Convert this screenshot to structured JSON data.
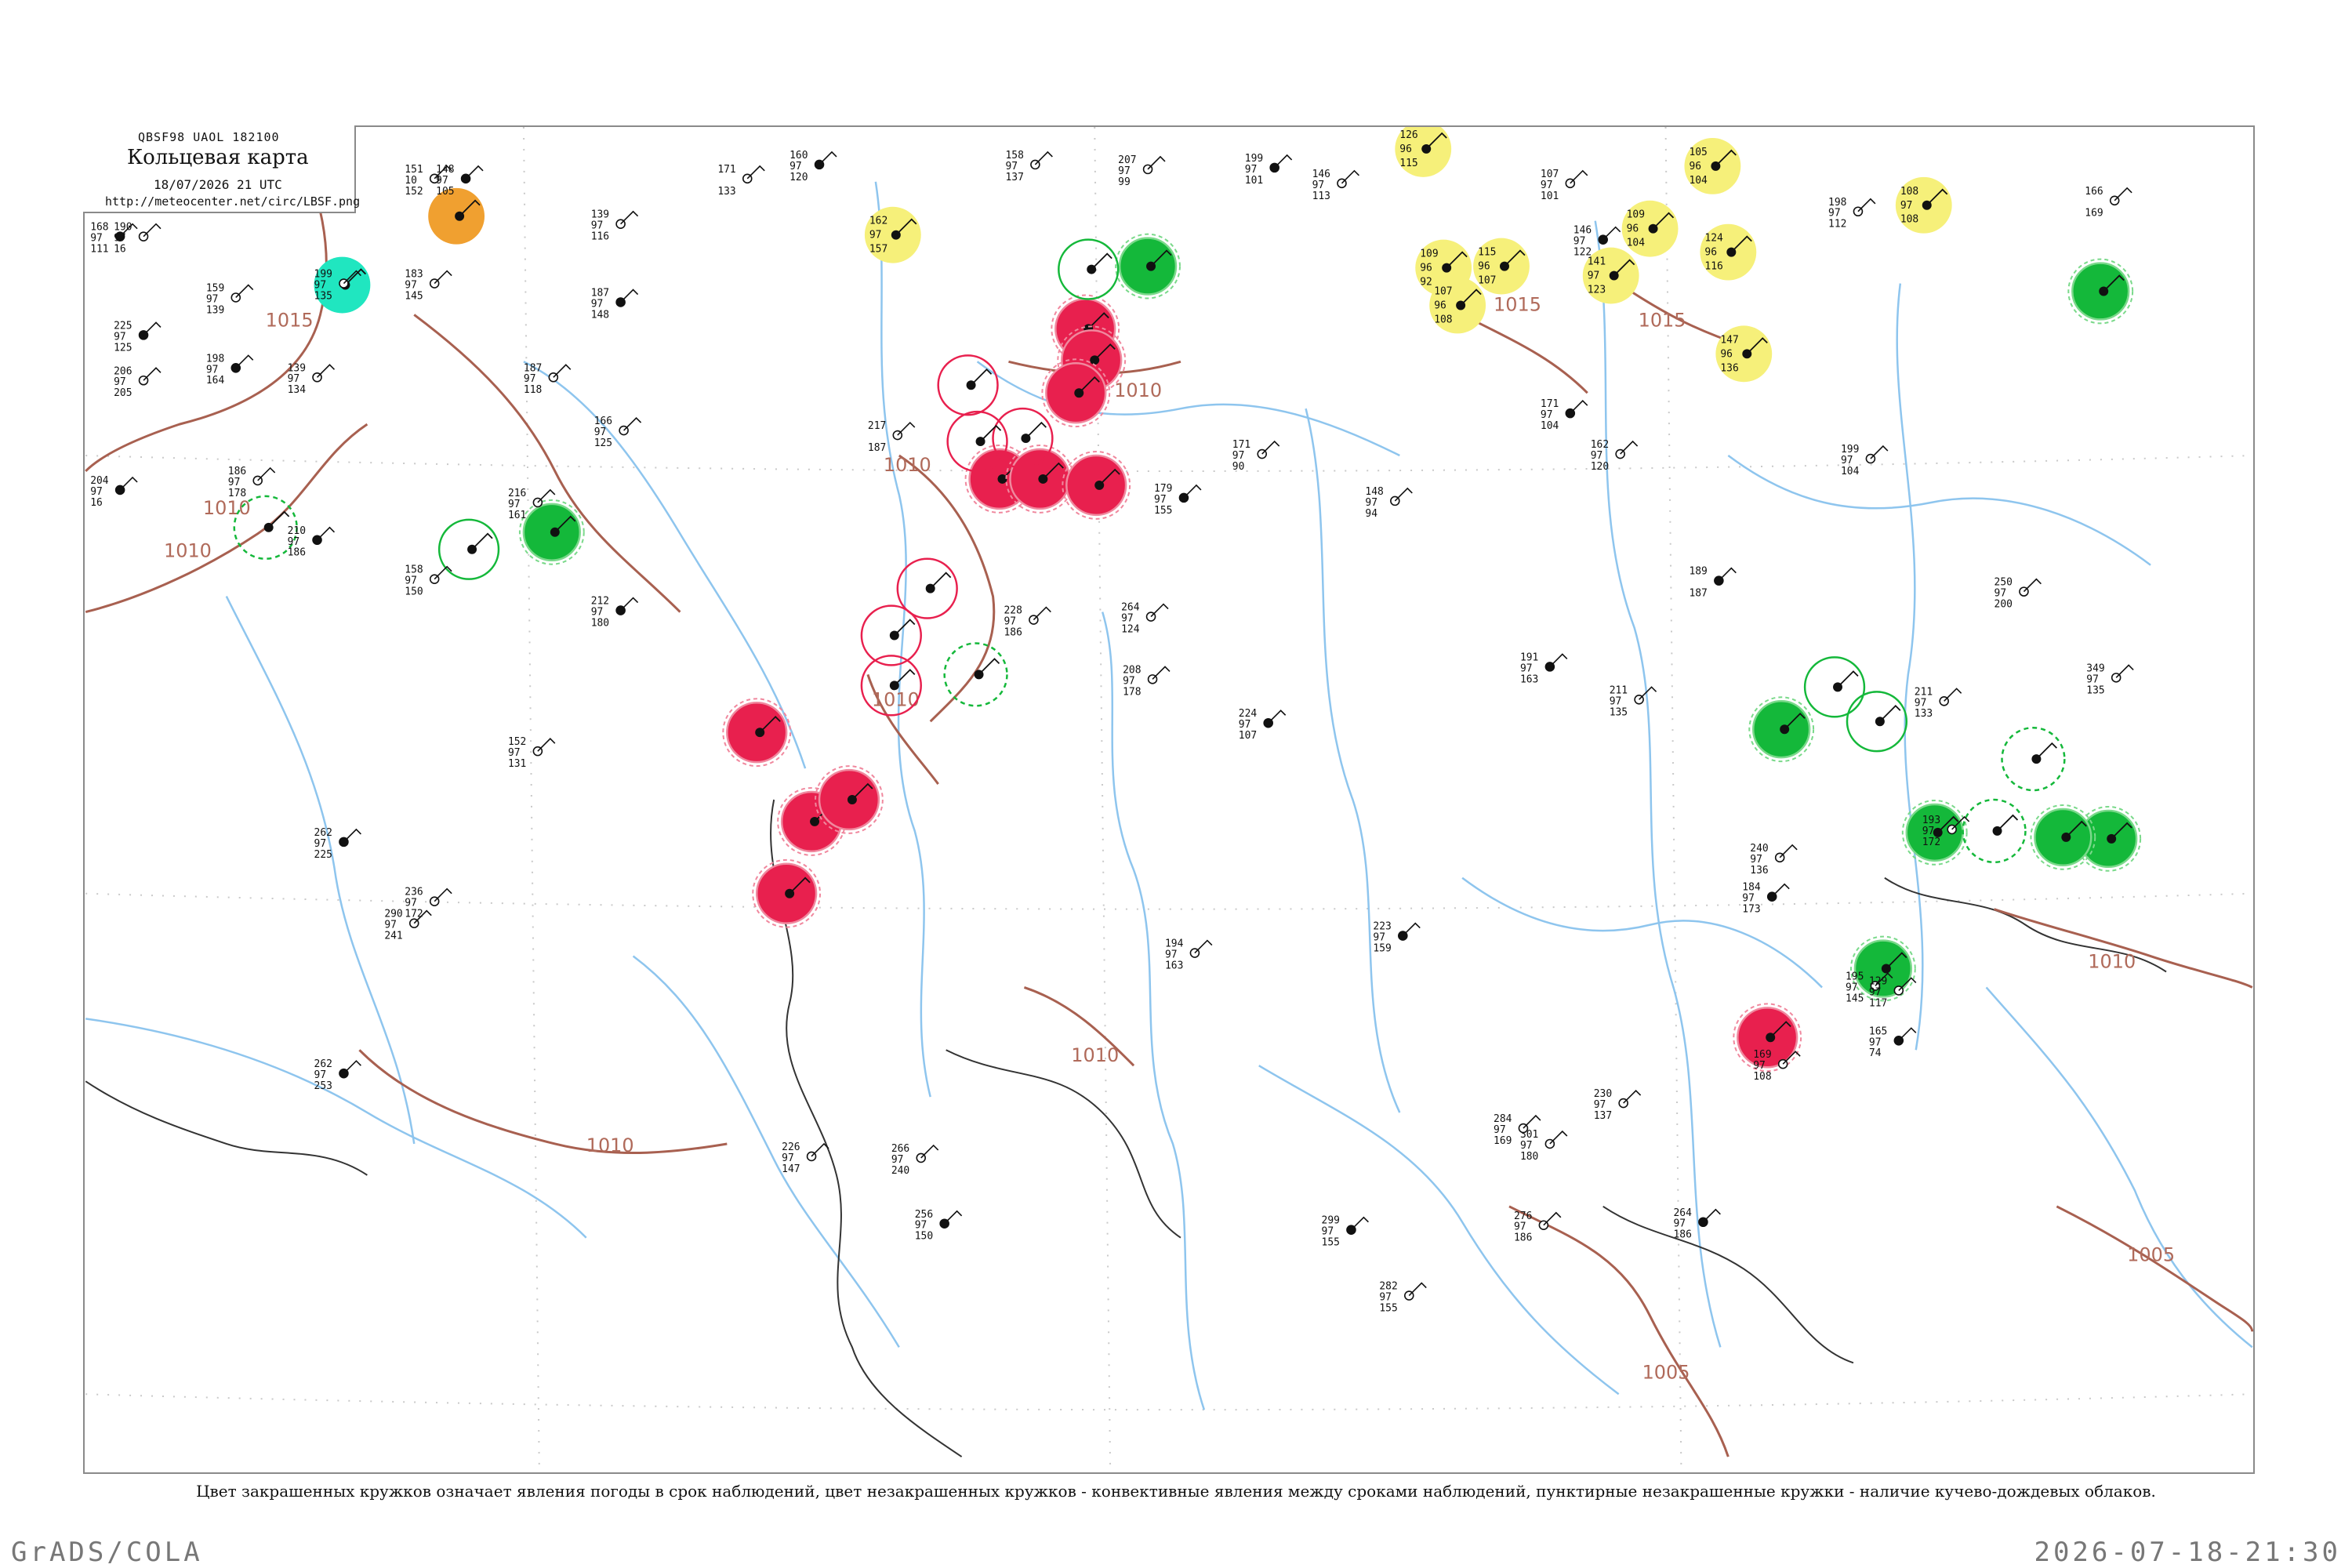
{
  "header_box": {
    "code": "QBSF98  UAOL  182100",
    "title": "Кольцевая карта",
    "datetime": "18/07/2026 21 UTC",
    "url": "http://meteocenter.net/circ/LBSF.png"
  },
  "caption": "Цвет закрашенных кружков означает явления погоды в срок наблюдений, цвет незакрашенных кружков - конвективные явления между сроками наблюдений, пунктирные незакрашенные кружки - наличие кучево-дождевых облаков.",
  "footer": {
    "left": "GrADS/COLA",
    "right": "2026-07-18-21:30"
  },
  "colors": {
    "thunderstorm": "#e8204e",
    "rain": "#14b83a",
    "haze": "#f6f07a",
    "fog": "#20e6c0",
    "dust": "#f0a030",
    "isobar": "#a86050",
    "river": "#8ec5ee"
  },
  "isobars": [
    {
      "label": "1015"
    },
    {
      "label": "1010"
    },
    {
      "label": "1010"
    },
    {
      "label": "1010"
    },
    {
      "label": "1010"
    },
    {
      "label": "1010"
    },
    {
      "label": "1010"
    },
    {
      "label": "1015"
    },
    {
      "label": "1015"
    },
    {
      "label": "1010"
    },
    {
      "label": "1010"
    },
    {
      "label": "1005"
    },
    {
      "label": "1005"
    }
  ],
  "weather_circles": [
    {
      "type": "haze",
      "top": "126",
      "mid": "96",
      "bot": "115"
    },
    {
      "type": "haze",
      "top": "162",
      "mid": "97",
      "bot": "157"
    },
    {
      "type": "haze",
      "top": "109",
      "mid": "96",
      "bot": "92"
    },
    {
      "type": "haze",
      "top": "107",
      "mid": "96",
      "bot": "108"
    },
    {
      "type": "haze",
      "top": "115",
      "mid": "96",
      "bot": "107"
    },
    {
      "type": "haze",
      "top": "141",
      "mid": "97",
      "bot": "123"
    },
    {
      "type": "haze",
      "top": "109",
      "mid": "96",
      "bot": "104"
    },
    {
      "type": "haze",
      "top": "105",
      "mid": "96",
      "bot": "104"
    },
    {
      "type": "haze",
      "top": "124",
      "mid": "96",
      "bot": "116"
    },
    {
      "type": "haze",
      "top": "147",
      "mid": "96",
      "bot": "136"
    },
    {
      "type": "haze",
      "top": "108",
      "mid": "97",
      "bot": "108"
    },
    {
      "type": "dust",
      "top": "",
      "mid": "",
      "bot": ""
    },
    {
      "type": "fog",
      "top": "",
      "mid": "",
      "bot": ""
    },
    {
      "type": "rain",
      "top": "",
      "mid": "",
      "bot": ""
    },
    {
      "type": "rain",
      "top": "",
      "mid": "",
      "bot": ""
    },
    {
      "type": "rain",
      "top": "",
      "mid": "",
      "bot": ""
    },
    {
      "type": "rain",
      "top": "",
      "mid": "",
      "bot": ""
    },
    {
      "type": "rain",
      "top": "",
      "mid": "",
      "bot": ""
    },
    {
      "type": "rain",
      "top": "",
      "mid": "",
      "bot": ""
    },
    {
      "type": "rain",
      "top": "",
      "mid": "",
      "bot": ""
    },
    {
      "type": "rain",
      "top": "",
      "mid": "",
      "bot": ""
    },
    {
      "type": "thunderstorm",
      "top": "",
      "mid": "",
      "bot": ""
    },
    {
      "type": "thunderstorm",
      "top": "",
      "mid": "",
      "bot": ""
    },
    {
      "type": "thunderstorm",
      "top": "",
      "mid": "",
      "bot": ""
    },
    {
      "type": "thunderstorm",
      "top": "",
      "mid": "",
      "bot": ""
    },
    {
      "type": "thunderstorm",
      "top": "",
      "mid": "",
      "bot": ""
    },
    {
      "type": "thunderstorm",
      "top": "",
      "mid": "",
      "bot": ""
    },
    {
      "type": "thunderstorm",
      "top": "",
      "mid": "",
      "bot": ""
    },
    {
      "type": "thunderstorm",
      "top": "",
      "mid": "",
      "bot": ""
    },
    {
      "type": "thunderstorm",
      "top": "",
      "mid": "",
      "bot": ""
    },
    {
      "type": "thunderstorm",
      "top": "",
      "mid": "",
      "bot": ""
    },
    {
      "type": "thunderstorm",
      "top": "",
      "mid": "",
      "bot": ""
    },
    {
      "type": "thunderstorm-outline",
      "top": "",
      "mid": "",
      "bot": ""
    },
    {
      "type": "thunderstorm-outline",
      "top": "",
      "mid": "",
      "bot": ""
    },
    {
      "type": "thunderstorm-outline",
      "top": "",
      "mid": "",
      "bot": ""
    },
    {
      "type": "thunderstorm-outline",
      "top": "",
      "mid": "",
      "bot": ""
    },
    {
      "type": "thunderstorm-outline",
      "top": "",
      "mid": "",
      "bot": ""
    },
    {
      "type": "thunderstorm-outline",
      "top": "",
      "mid": "",
      "bot": ""
    },
    {
      "type": "rain-outline",
      "top": "",
      "mid": "",
      "bot": ""
    },
    {
      "type": "rain-outline",
      "top": "",
      "mid": "",
      "bot": ""
    },
    {
      "type": "rain-outline",
      "top": "",
      "mid": "",
      "bot": ""
    },
    {
      "type": "rain-outline",
      "top": "",
      "mid": "",
      "bot": ""
    },
    {
      "type": "cb-dashed",
      "top": "",
      "mid": "",
      "bot": ""
    },
    {
      "type": "cb-dashed",
      "top": "",
      "mid": "",
      "bot": ""
    },
    {
      "type": "cb-dashed",
      "top": "",
      "mid": "",
      "bot": ""
    },
    {
      "type": "cb-dashed",
      "top": "",
      "mid": "",
      "bot": ""
    }
  ],
  "stations": [
    {
      "top": "168",
      "mid": "97",
      "bot": "111"
    },
    {
      "top": "190",
      "mid": "97",
      "bot": "16"
    },
    {
      "top": "151",
      "mid": "10",
      "bot": "152"
    },
    {
      "top": "148",
      "mid": "97",
      "bot": "105"
    },
    {
      "top": "139",
      "mid": "97",
      "bot": "116"
    },
    {
      "top": "171",
      "mid": "",
      "bot": "133"
    },
    {
      "top": "160",
      "mid": "97",
      "bot": "120"
    },
    {
      "top": "158",
      "mid": "97",
      "bot": "137"
    },
    {
      "top": "207",
      "mid": "97",
      "bot": "99"
    },
    {
      "top": "199",
      "mid": "97",
      "bot": "101"
    },
    {
      "top": "146",
      "mid": "97",
      "bot": "113"
    },
    {
      "top": "107",
      "mid": "97",
      "bot": "101"
    },
    {
      "top": "146",
      "mid": "97",
      "bot": "122"
    },
    {
      "top": "198",
      "mid": "97",
      "bot": "112"
    },
    {
      "top": "166",
      "mid": "",
      "bot": "169"
    },
    {
      "top": "225",
      "mid": "97",
      "bot": "125"
    },
    {
      "top": "206",
      "mid": "97",
      "bot": "205"
    },
    {
      "top": "159",
      "mid": "97",
      "bot": "139"
    },
    {
      "top": "198",
      "mid": "97",
      "bot": "164"
    },
    {
      "top": "199",
      "mid": "97",
      "bot": "135"
    },
    {
      "top": "183",
      "mid": "97",
      "bot": "145"
    },
    {
      "top": "187",
      "mid": "97",
      "bot": "148"
    },
    {
      "top": "186",
      "mid": "97",
      "bot": "178"
    },
    {
      "top": "139",
      "mid": "97",
      "bot": "134"
    },
    {
      "top": "204",
      "mid": "97",
      "bot": "16"
    },
    {
      "top": "187",
      "mid": "97",
      "bot": "118"
    },
    {
      "top": "166",
      "mid": "97",
      "bot": "125"
    },
    {
      "top": "210",
      "mid": "97",
      "bot": "186"
    },
    {
      "top": "158",
      "mid": "97",
      "bot": "150"
    },
    {
      "top": "216",
      "mid": "97",
      "bot": "161"
    },
    {
      "top": "212",
      "mid": "97",
      "bot": "180"
    },
    {
      "top": "152",
      "mid": "97",
      "bot": "131"
    },
    {
      "top": "217",
      "mid": "",
      "bot": "187"
    },
    {
      "top": "179",
      "mid": "97",
      "bot": "155"
    },
    {
      "top": "171",
      "mid": "97",
      "bot": "90"
    },
    {
      "top": "148",
      "mid": "97",
      "bot": "94"
    },
    {
      "top": "171",
      "mid": "97",
      "bot": "104"
    },
    {
      "top": "162",
      "mid": "97",
      "bot": "120"
    },
    {
      "top": "199",
      "mid": "97",
      "bot": "104"
    },
    {
      "top": "189",
      "mid": "",
      "bot": "187"
    },
    {
      "top": "228",
      "mid": "97",
      "bot": "186"
    },
    {
      "top": "264",
      "mid": "97",
      "bot": "124"
    },
    {
      "top": "262",
      "mid": "97",
      "bot": "225"
    },
    {
      "top": "236",
      "mid": "97",
      "bot": "172"
    },
    {
      "top": "208",
      "mid": "97",
      "bot": "178"
    },
    {
      "top": "224",
      "mid": "97",
      "bot": "107"
    },
    {
      "top": "211",
      "mid": "97",
      "bot": "133"
    },
    {
      "top": "250",
      "mid": "97",
      "bot": "200"
    },
    {
      "top": "191",
      "mid": "97",
      "bot": "163"
    },
    {
      "top": "211",
      "mid": "97",
      "bot": "135"
    },
    {
      "top": "290",
      "mid": "97",
      "bot": "241"
    },
    {
      "top": "262",
      "mid": "97",
      "bot": "253"
    },
    {
      "top": "226",
      "mid": "97",
      "bot": "147"
    },
    {
      "top": "194",
      "mid": "97",
      "bot": "163"
    },
    {
      "top": "223",
      "mid": "97",
      "bot": "159"
    },
    {
      "top": "240",
      "mid": "97",
      "bot": "136"
    },
    {
      "top": "193",
      "mid": "97",
      "bot": "172"
    },
    {
      "top": "184",
      "mid": "97",
      "bot": "173"
    },
    {
      "top": "349",
      "mid": "97",
      "bot": "135"
    },
    {
      "top": "195",
      "mid": "97",
      "bot": "145"
    },
    {
      "top": "299",
      "mid": "97",
      "bot": "155"
    },
    {
      "top": "282",
      "mid": "97",
      "bot": "155"
    },
    {
      "top": "276",
      "mid": "97",
      "bot": "186"
    },
    {
      "top": "256",
      "mid": "97",
      "bot": "150"
    },
    {
      "top": "266",
      "mid": "97",
      "bot": "240"
    },
    {
      "top": "301",
      "mid": "97",
      "bot": "180"
    },
    {
      "top": "264",
      "mid": "97",
      "bot": "186"
    },
    {
      "top": "284",
      "mid": "97",
      "bot": "169"
    },
    {
      "top": "230",
      "mid": "97",
      "bot": "137"
    },
    {
      "top": "165",
      "mid": "97",
      "bot": "74"
    },
    {
      "top": "169",
      "mid": "97",
      "bot": "108"
    },
    {
      "top": "129",
      "mid": "97",
      "bot": "117"
    }
  ]
}
